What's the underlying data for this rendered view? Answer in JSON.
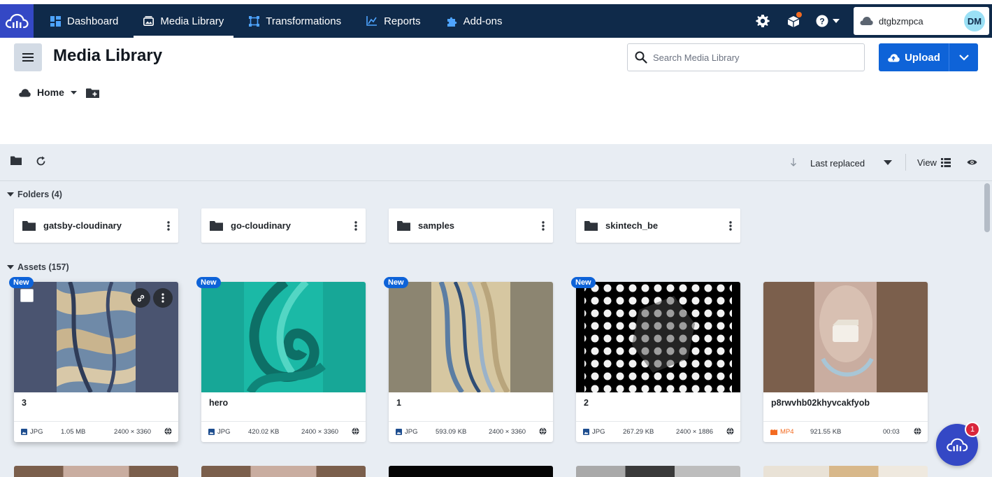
{
  "nav": {
    "items": [
      {
        "label": "Dashboard",
        "icon": "dashboard-icon"
      },
      {
        "label": "Media Library",
        "icon": "media-library-icon",
        "active": true
      },
      {
        "label": "Transformations",
        "icon": "transformations-icon"
      },
      {
        "label": "Reports",
        "icon": "reports-icon"
      },
      {
        "label": "Add-ons",
        "icon": "addons-icon"
      }
    ],
    "cloud_name": "dtgbzmpca",
    "avatar_initials": "DM"
  },
  "header": {
    "title": "Media Library",
    "search_placeholder": "Search Media Library",
    "upload_label": "Upload"
  },
  "breadcrumb": {
    "home": "Home"
  },
  "toolbar": {
    "sort_label": "Last replaced",
    "view_label": "View"
  },
  "folders": {
    "heading": "Folders (4)",
    "items": [
      {
        "name": "gatsby-cloudinary"
      },
      {
        "name": "go-cloudinary"
      },
      {
        "name": "samples"
      },
      {
        "name": "skintech_be"
      }
    ]
  },
  "assets": {
    "heading": "Assets (157)",
    "badge_label": "New",
    "items": [
      {
        "name": "3",
        "format": "JPG",
        "size": "1.05 MB",
        "dims": "2400 × 3360",
        "is_new": true
      },
      {
        "name": "hero",
        "format": "JPG",
        "size": "420.02 KB",
        "dims": "2400 × 3360",
        "is_new": true
      },
      {
        "name": "1",
        "format": "JPG",
        "size": "593.09 KB",
        "dims": "2400 × 3360",
        "is_new": true
      },
      {
        "name": "2",
        "format": "JPG",
        "size": "267.29 KB",
        "dims": "2400 × 1886",
        "is_new": true
      },
      {
        "name": "p8rwvhb02khyvcakfyob",
        "format": "MP4",
        "size": "921.55 KB",
        "dims": "00:03",
        "is_new": false
      }
    ]
  },
  "fab": {
    "badge_count": "1"
  },
  "colors": {
    "nav_bg": "#0f2a4a",
    "brand": "#3448c5",
    "primary": "#0e63d8",
    "workspace_bg": "#e8edf3",
    "video_accent": "#f36b21"
  }
}
